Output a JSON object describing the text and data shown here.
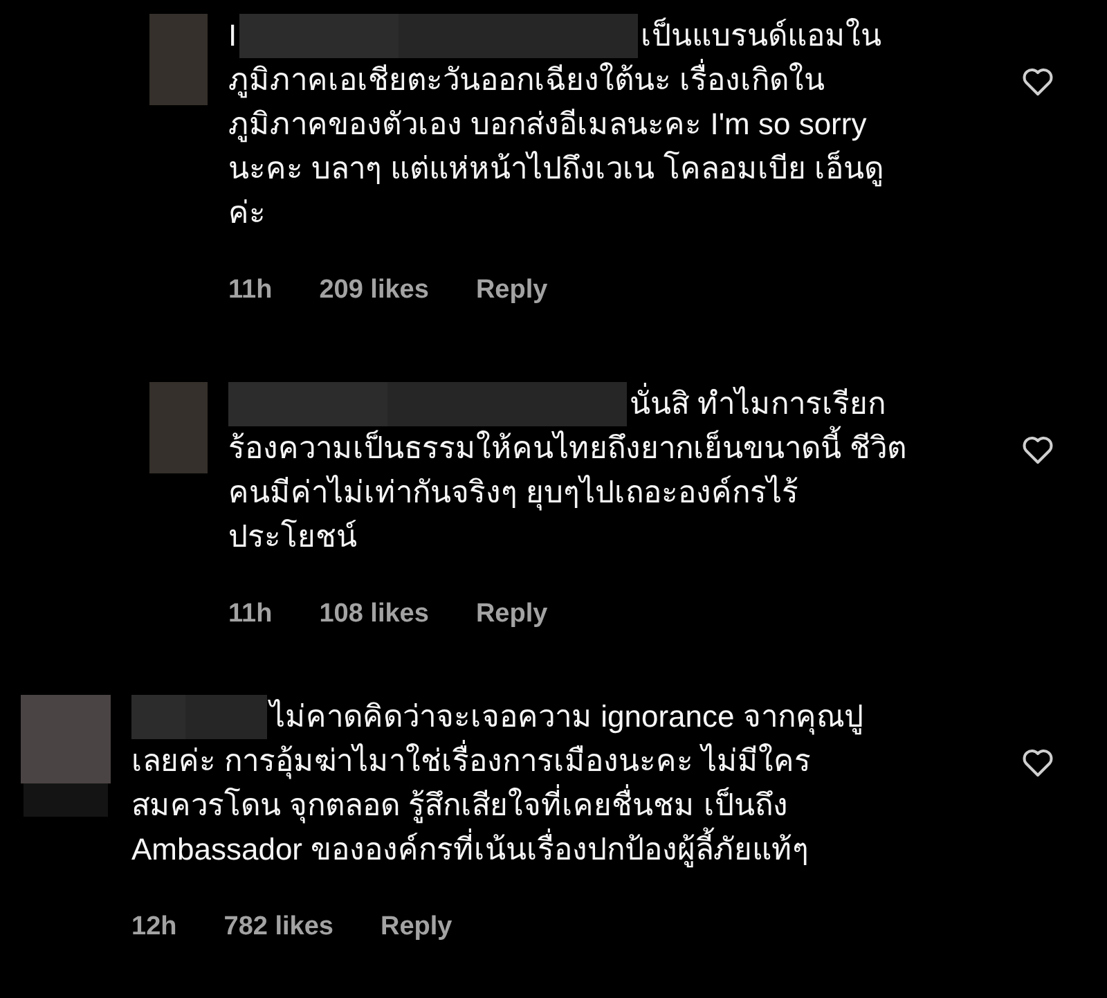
{
  "comments": [
    {
      "kind": "reply",
      "username": "I",
      "name_hidden": true,
      "first_line": "เป็นแบรนด์แอมใน",
      "text": "ภูมิภาคเอเชียตะวันออกเฉียงใต้นะ เรื่องเกิดใน\nภูมิภาคของตัวเอง บอกส่งอีเมลนะคะ I'm so sorry\nนะคะ บลาๆ แต่แห่หน้าไปถึงเวเน โคลอมเบีย เอ็นดู\nค่ะ",
      "time": "11h",
      "likes": "209 likes",
      "reply": "Reply",
      "liked": false
    },
    {
      "kind": "reply",
      "name_hidden": true,
      "first_line": "นั่นสิ ทำไมการเรียก",
      "text": "ร้องความเป็นธรรมให้คนไทยถึงยากเย็นขนาดนี้ ชีวิต\nคนมีค่าไม่เท่ากันจริงๆ ยุบๆไปเถอะองค์กรไร้\nประโยชน์",
      "time": "11h",
      "likes": "108 likes",
      "reply": "Reply",
      "liked": false
    },
    {
      "kind": "comment",
      "name_hidden": true,
      "first_line": "ไม่คาดคิดว่าจะเจอความ ignorance จากคุณปู",
      "text": "เลยค่ะ  การอุ้มฆ่าไมาใช่เรื่องการเมืองนะคะ ไม่มีใคร\nสมควรโดน  จุกตลอด รู้สึกเสียใจที่เคยชื่นชม เป็นถึง\nAmbassador ขององค์กรที่เน้นเรื่องปกป้องผู้ลี้ภัยแท้ๆ",
      "time": "12h",
      "likes": "782 likes",
      "reply": "Reply",
      "liked": false
    }
  ]
}
